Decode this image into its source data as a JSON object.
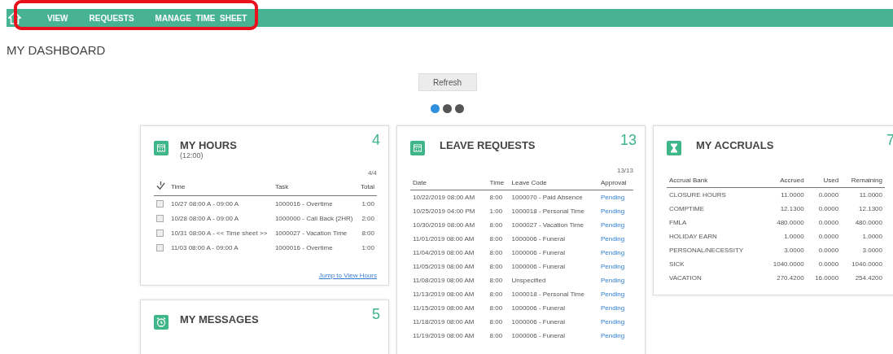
{
  "nav": {
    "items": [
      {
        "label": "VIEW"
      },
      {
        "label": "REQUESTS"
      },
      {
        "label": "MANAGE  TIME  SHEET"
      }
    ]
  },
  "page_title": "MY DASHBOARD",
  "refresh_button": "Refresh",
  "carousel_dots": [
    {
      "selected": true
    },
    {
      "selected": false
    },
    {
      "selected": false
    }
  ],
  "cards": [
    {
      "kind": "hours",
      "title": "MY HOURS",
      "subtitle": "(12:00)",
      "count": "4",
      "pager": "4/4",
      "columns": [
        "Time",
        "Task",
        "Total"
      ],
      "rows": [
        {
          "checked": false,
          "cells": [
            "10/27 08:00 A - 09:00 A",
            "1000016 - Overtime",
            "1:00"
          ]
        },
        {
          "checked": false,
          "cells": [
            "10/28 08:00 A - 09:00 A",
            "1000000 - Call Back (2HR)",
            "2:00"
          ]
        },
        {
          "checked": false,
          "cells": [
            "10/31 08:00 A - << Time sheet >>",
            "1000027 - Vacation Time",
            "8:00"
          ]
        },
        {
          "checked": false,
          "cells": [
            "11/03 08:00 A - 09:00 A",
            "1000016 - Overtime",
            "1:00"
          ]
        }
      ],
      "link": "Jump to View Hours"
    },
    {
      "kind": "leave",
      "title": "LEAVE REQUESTS",
      "count": "13",
      "pager": "13/13",
      "columns": [
        "Date",
        "Time",
        "Leave Code",
        "Approval"
      ],
      "rows": [
        {
          "cells": [
            "10/22/2019 08:00 AM",
            "8:00",
            "1000070 - Paid Absence",
            "Pending"
          ]
        },
        {
          "cells": [
            "10/25/2019 04:00 PM",
            "1:00",
            "1000018 - Personal Time",
            "Pending"
          ]
        },
        {
          "cells": [
            "10/30/2019 08:00 AM",
            "8:00",
            "1000027 - Vacation Time",
            "Pending"
          ]
        },
        {
          "cells": [
            "11/01/2019 08:00 AM",
            "8:00",
            "1000006 - Funeral",
            "Pending"
          ]
        },
        {
          "cells": [
            "11/04/2019 08:00 AM",
            "8:00",
            "1000006 - Funeral",
            "Pending"
          ]
        },
        {
          "cells": [
            "11/05/2019 08:00 AM",
            "8:00",
            "1000006 - Funeral",
            "Pending"
          ]
        },
        {
          "cells": [
            "11/08/2019 08:00 AM",
            "8:00",
            "Unspecified",
            "Pending"
          ]
        },
        {
          "cells": [
            "11/13/2019 08:00 AM",
            "8:00",
            "1000018 - Personal Time",
            "Pending"
          ]
        },
        {
          "cells": [
            "11/15/2019 08:00 AM",
            "8:00",
            "1000006 - Funeral",
            "Pending"
          ]
        },
        {
          "cells": [
            "11/18/2019 08:00 AM",
            "8:00",
            "1000006 - Funeral",
            "Pending"
          ]
        },
        {
          "cells": [
            "11/19/2019 08:00 AM",
            "8:00",
            "1000006 - Funeral",
            "Pending"
          ]
        }
      ]
    },
    {
      "kind": "accruals",
      "title": "MY ACCRUALS",
      "count": "7",
      "columns": [
        "Accrual Bank",
        "Accrued",
        "Used",
        "Remaining"
      ],
      "rows": [
        {
          "cells": [
            "CLOSURE HOURS",
            "11.0000",
            "0.0000",
            "11.0000"
          ]
        },
        {
          "cells": [
            "COMPTIME",
            "12.1300",
            "0.0000",
            "12.1300"
          ]
        },
        {
          "cells": [
            "FMLA",
            "480.0000",
            "0.0000",
            "480.0000"
          ]
        },
        {
          "cells": [
            "HOLIDAY EARN",
            "1.0000",
            "0.0000",
            "1.0000"
          ]
        },
        {
          "cells": [
            "PERSONAL/NECESSITY",
            "3.0000",
            "0.0000",
            "3.0000"
          ]
        },
        {
          "cells": [
            "SICK",
            "1040.0000",
            "0.0000",
            "1040.0000"
          ]
        },
        {
          "cells": [
            "VACATION",
            "270.4200",
            "16.0000",
            "254.4200"
          ]
        }
      ]
    },
    {
      "kind": "messages",
      "title": "MY MESSAGES",
      "count": "5"
    }
  ]
}
